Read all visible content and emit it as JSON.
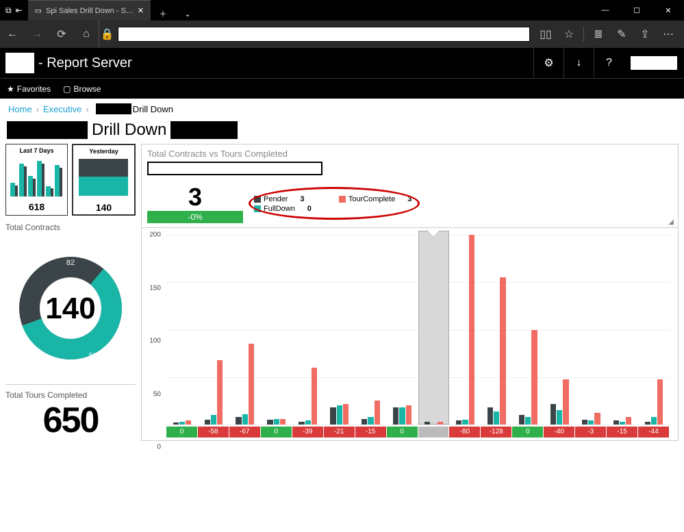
{
  "browser": {
    "tab_title": "Spi Sales Drill Down - S…"
  },
  "app": {
    "brand_suffix": "- Report Server",
    "nav_favorites": "Favorites",
    "nav_browse": "Browse"
  },
  "breadcrumb": {
    "home": "Home",
    "executive": "Executive",
    "trailing": "Drill Down"
  },
  "page_title": "Drill Down",
  "tiles": {
    "last7": {
      "title": "Last 7 Days",
      "value": "618"
    },
    "yesterday": {
      "title": "Yesterday",
      "value": "140"
    }
  },
  "left": {
    "contracts_label": "Total Contracts",
    "contracts_value": "140",
    "donut_top": "82",
    "donut_bottom": "58",
    "tours_label": "Total Tours Completed",
    "tours_value": "650"
  },
  "right": {
    "header": "Total Contracts vs Tours Completed",
    "big_number": "3",
    "pct": "-0%",
    "legend": {
      "pender": {
        "label": "Pender",
        "value": "3"
      },
      "fulldown": {
        "label": "FullDown",
        "value": "0"
      },
      "tourcomplete": {
        "label": "TourComplete",
        "value": "3"
      }
    }
  },
  "colors": {
    "teal": "#19b6a8",
    "dark": "#3b4448",
    "red": "#f16c62",
    "green": "#2fb04a",
    "redCell": "#d93a3a",
    "greenCell": "#2fb04a"
  },
  "chart_data": {
    "type": "bar",
    "title": "Total Contracts vs Tours Completed",
    "ylabel": "",
    "ylim": [
      0,
      200
    ],
    "yticks": [
      0,
      50,
      100,
      150,
      200
    ],
    "series_names": [
      "Pender",
      "FullDown",
      "TourComplete"
    ],
    "series_colors": [
      "#3b4448",
      "#19b6a8",
      "#f16c62"
    ],
    "categories": [
      "0",
      "-58",
      "-67",
      "0",
      "-39",
      "-21",
      "-15",
      "0",
      "",
      "-80",
      "-128",
      "0",
      "-40",
      "-3",
      "-15",
      "-44"
    ],
    "category_status": [
      "pos",
      "neg",
      "neg",
      "pos",
      "neg",
      "neg",
      "neg",
      "pos",
      "neutral",
      "neg",
      "neg",
      "pos",
      "neg",
      "neg",
      "neg",
      "neg"
    ],
    "highlight_index": 8,
    "series": [
      {
        "name": "Pender",
        "values": [
          2,
          5,
          8,
          5,
          3,
          18,
          6,
          18,
          3,
          4,
          18,
          10,
          22,
          5,
          4,
          3
        ]
      },
      {
        "name": "FullDown",
        "values": [
          3,
          10,
          11,
          6,
          4,
          20,
          8,
          18,
          0,
          5,
          14,
          8,
          15,
          4,
          3,
          8
        ]
      },
      {
        "name": "TourComplete",
        "values": [
          4,
          68,
          85,
          6,
          60,
          22,
          25,
          20,
          3,
          200,
          155,
          100,
          48,
          12,
          8,
          48
        ]
      }
    ]
  }
}
